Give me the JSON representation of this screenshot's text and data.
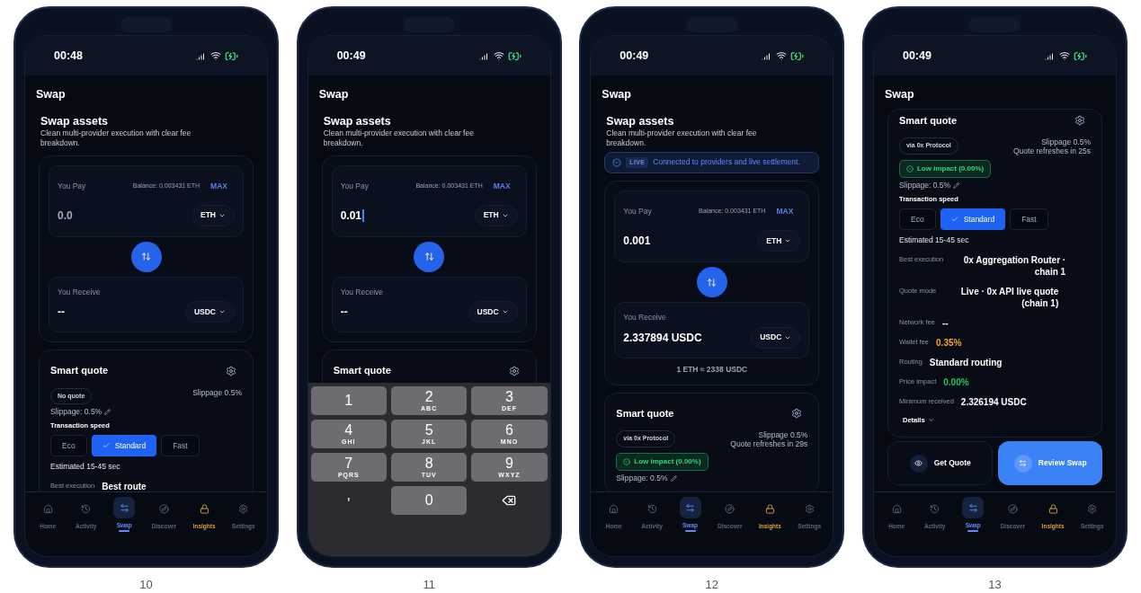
{
  "screens": [
    {
      "caption": "10",
      "time": "00:48",
      "header": "Swap",
      "blocks": [
        {
          "kind": "intro",
          "title": "Swap assets",
          "subtitle": "Clean multi-provider execution with clear fee breakdown."
        },
        {
          "kind": "swap",
          "pay": {
            "label": "You Pay",
            "balance": "Balance: 0.003431 ETH",
            "max": "MAX",
            "placeholder": "0.0",
            "focused": false,
            "token": "ETH"
          },
          "receive": {
            "label": "You Receive",
            "value": "--",
            "token": "USDC"
          }
        },
        {
          "kind": "quote",
          "title": "Smart quote",
          "pill": "No quote",
          "notes": [
            "Slippage 0.5%"
          ],
          "slippage": "Slippage: 0.5%",
          "speed_label": "Transaction speed",
          "speeds": [
            {
              "label": "Eco",
              "selected": false
            },
            {
              "label": "Standard",
              "selected": true
            },
            {
              "label": "Fast",
              "selected": false
            }
          ],
          "estimate": "Estimated 15-45 sec",
          "rows": [
            {
              "label": "Best execution",
              "value": "Best route",
              "color": "#ffffff"
            }
          ]
        }
      ],
      "nav": [
        {
          "label": "Home",
          "selected": false,
          "accent": false
        },
        {
          "label": "Activity",
          "selected": false,
          "accent": false
        },
        {
          "label": "Swap",
          "selected": true,
          "accent": false
        },
        {
          "label": "Discover",
          "selected": false,
          "accent": false
        },
        {
          "label": "Insights",
          "selected": false,
          "accent": true
        },
        {
          "label": "Settings",
          "selected": false,
          "accent": false
        }
      ]
    },
    {
      "caption": "11",
      "time": "00:49",
      "header": "Swap",
      "blocks": [
        {
          "kind": "intro",
          "title": "Swap assets",
          "subtitle": "Clean multi-provider execution with clear fee breakdown."
        },
        {
          "kind": "swap",
          "pay": {
            "label": "You Pay",
            "balance": "Balance: 0.003431 ETH",
            "max": "MAX",
            "value": "0.01",
            "focused": true,
            "token": "ETH"
          },
          "receive": {
            "label": "You Receive",
            "value": "--",
            "token": "USDC"
          }
        },
        {
          "kind": "quote",
          "title": "Smart quote"
        }
      ],
      "keyboard": [
        {
          "kind": "digit",
          "main": "1"
        },
        {
          "kind": "digit",
          "main": "2",
          "letters": "ABC"
        },
        {
          "kind": "digit",
          "main": "3",
          "letters": "DEF"
        },
        {
          "kind": "digit",
          "main": "4",
          "letters": "GHI"
        },
        {
          "kind": "digit",
          "main": "5",
          "letters": "JKL"
        },
        {
          "kind": "digit",
          "main": "6",
          "letters": "MNO"
        },
        {
          "kind": "digit",
          "main": "7",
          "letters": "PQRS"
        },
        {
          "kind": "digit",
          "main": "8",
          "letters": "TUV"
        },
        {
          "kind": "digit",
          "main": "9",
          "letters": "WXYZ"
        },
        {
          "kind": "plain",
          "main": ","
        },
        {
          "kind": "digit",
          "main": "0"
        },
        {
          "kind": "delete"
        }
      ]
    },
    {
      "caption": "12",
      "time": "00:49",
      "header": "Swap",
      "blocks": [
        {
          "kind": "intro",
          "title": "Swap assets",
          "subtitle": "Clean multi-provider execution with clear fee breakdown."
        },
        {
          "kind": "live",
          "badge": "LIVE",
          "text": "Connected to providers and live settlement."
        },
        {
          "kind": "swap",
          "pay": {
            "label": "You Pay",
            "balance": "Balance: 0.003431 ETH",
            "max": "MAX",
            "value": "0.001",
            "focused": false,
            "token": "ETH"
          },
          "receive": {
            "label": "You Receive",
            "value": "2.337894 USDC",
            "token": "USDC"
          },
          "rate": "1 ETH ≈ 2338 USDC"
        },
        {
          "kind": "quote",
          "title": "Smart quote",
          "pill": "via 0x Protocol",
          "notes": [
            "Slippage 0.5%",
            "Quote refreshes in 29s"
          ],
          "impact": "Low impact (0.00%)",
          "slippage": "Slippage: 0.5%"
        }
      ],
      "nav": [
        {
          "label": "Home",
          "selected": false,
          "accent": false
        },
        {
          "label": "Activity",
          "selected": false,
          "accent": false
        },
        {
          "label": "Swap",
          "selected": true,
          "accent": false
        },
        {
          "label": "Discover",
          "selected": false,
          "accent": false
        },
        {
          "label": "Insights",
          "selected": false,
          "accent": true
        },
        {
          "label": "Settings",
          "selected": false,
          "accent": false
        }
      ]
    },
    {
      "caption": "13",
      "time": "00:49",
      "header": "Swap",
      "blocks": [
        {
          "kind": "quote",
          "title": "Smart quote",
          "pill": "via 0x Protocol",
          "notes": [
            "Slippage 0.5%",
            "Quote refreshes in 25s"
          ],
          "impact": "Low impact (0.00%)",
          "slippage": "Slippage: 0.5%",
          "speed_label": "Transaction speed",
          "speeds": [
            {
              "label": "Eco",
              "selected": false
            },
            {
              "label": "Standard",
              "selected": true
            },
            {
              "label": "Fast",
              "selected": false
            }
          ],
          "estimate": "Estimated 15-45 sec",
          "rows": [
            {
              "label": "Best execution",
              "value": "0x Aggregation Router · chain 1",
              "color": "#ffffff"
            },
            {
              "label": "Quote mode",
              "value": "Live · 0x API live quote (chain 1)",
              "color": "#ffffff"
            },
            {
              "label": "Network fee",
              "value": "--",
              "color": "#ffffff"
            },
            {
              "label": "Wallet fee",
              "value": "0.35%",
              "color": "#f5a524"
            },
            {
              "label": "Routing",
              "value": "Standard routing",
              "color": "#ffffff"
            },
            {
              "label": "Price impact",
              "value": "0.00%",
              "color": "#22c55e"
            },
            {
              "label": "Minimum received",
              "value": "2.326194 USDC",
              "color": "#ffffff"
            }
          ],
          "details": "Details"
        },
        {
          "kind": "actions",
          "buttons": [
            {
              "kind": "secondary",
              "label": "Get Quote"
            },
            {
              "kind": "primary",
              "label": "Review Swap"
            }
          ]
        }
      ],
      "nav": [
        {
          "label": "Home",
          "selected": false,
          "accent": false
        },
        {
          "label": "Activity",
          "selected": false,
          "accent": false
        },
        {
          "label": "Swap",
          "selected": true,
          "accent": false
        },
        {
          "label": "Discover",
          "selected": false,
          "accent": false
        },
        {
          "label": "Insights",
          "selected": false,
          "accent": true
        },
        {
          "label": "Settings",
          "selected": false,
          "accent": false
        }
      ]
    }
  ]
}
